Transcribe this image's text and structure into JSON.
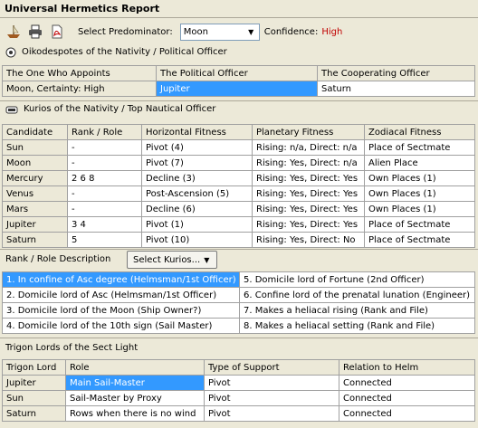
{
  "app": {
    "title": "Universal Hermetics Report"
  },
  "toolbar": {
    "predominator_label": "Select Predominator:",
    "predominator_value": "Moon",
    "confidence_label": "Confidence:",
    "confidence_value": "High"
  },
  "oikodespotes": {
    "heading": "Oikodespotes of the Nativity / Political Officer",
    "headers": [
      "The One Who Appoints",
      "The Political Officer",
      "The Cooperating Officer"
    ],
    "row": [
      "Moon, Certainty: High",
      "Jupiter",
      "Saturn"
    ]
  },
  "kurios": {
    "heading": "Kurios of the Nativity / Top Nautical Officer",
    "headers": [
      "Candidate",
      "Rank / Role",
      "Horizontal Fitness",
      "Planetary Fitness",
      "Zodiacal Fitness"
    ],
    "rows": [
      [
        "Sun",
        "-",
        "Pivot (4)",
        "Rising: n/a, Direct: n/a",
        "Place of Sectmate"
      ],
      [
        "Moon",
        "-",
        "Pivot (7)",
        "Rising: Yes, Direct: n/a",
        "Alien Place"
      ],
      [
        "Mercury",
        "2 6 8",
        "Decline (3)",
        "Rising: Yes, Direct: Yes",
        "Own Places (1)"
      ],
      [
        "Venus",
        "-",
        "Post-Ascension (5)",
        "Rising: Yes, Direct: Yes",
        "Own Places (1)"
      ],
      [
        "Mars",
        "-",
        "Decline (6)",
        "Rising: Yes, Direct: Yes",
        "Own Places (1)"
      ],
      [
        "Jupiter",
        "3 4",
        "Pivot (1)",
        "Rising: Yes, Direct: Yes",
        "Place of Sectmate"
      ],
      [
        "Saturn",
        "5",
        "Pivot (10)",
        "Rising: Yes, Direct: No",
        "Place of Sectmate"
      ]
    ]
  },
  "rank_role": {
    "label": "Rank / Role Description",
    "button": "Select Kurios...",
    "left": [
      "1. In confine of Asc degree (Helmsman/1st Officer)",
      "2. Domicile lord of Asc (Helmsman/1st Officer)",
      "3. Domicile lord of the Moon (Ship Owner?)",
      "4. Domicile lord of the 10th sign (Sail Master)"
    ],
    "right": [
      "5. Domicile lord of Fortune (2nd Officer)",
      "6. Confine lord of the prenatal lunation (Engineer)",
      "7. Makes a heliacal rising (Rank and File)",
      "8. Makes a heliacal setting (Rank and File)"
    ]
  },
  "trigon": {
    "heading": "Trigon Lords of the Sect Light",
    "headers": [
      "Trigon Lord",
      "Role",
      "Type of Support",
      "Relation to Helm"
    ],
    "rows": [
      [
        "Jupiter",
        "Main Sail-Master",
        "Pivot",
        "Connected"
      ],
      [
        "Sun",
        "Sail-Master by Proxy",
        "Pivot",
        "Connected"
      ],
      [
        "Saturn",
        "Rows when there is no wind",
        "Pivot",
        "Connected"
      ]
    ]
  },
  "colors": {
    "selection": "#3399ff",
    "confidence": "#c00000"
  }
}
